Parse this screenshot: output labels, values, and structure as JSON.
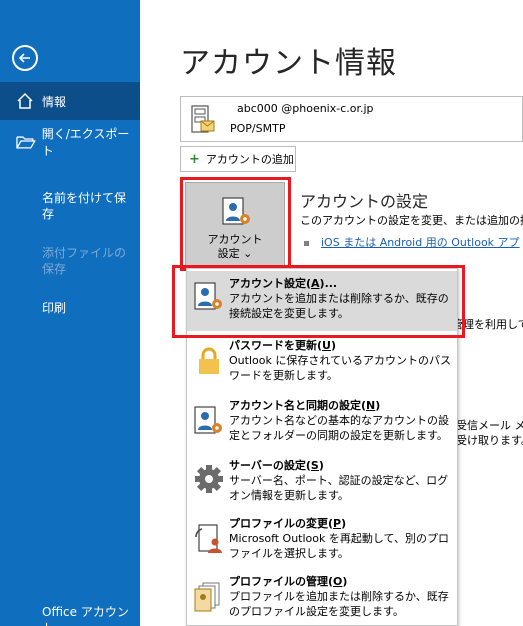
{
  "sidebar": {
    "info": "情報",
    "open_export": "開く/エクスポート",
    "save_as": "名前を付けて保存",
    "save_attachments": "添付ファイルの保存",
    "print": "印刷",
    "office_account": "Office アカウント"
  },
  "page_title": "アカウント情報",
  "account": {
    "email": "abc000 @phoenix-c.or.jp",
    "type": "POP/SMTP"
  },
  "add_account_label": "アカウントの追加",
  "account_settings_button": {
    "line1": "アカウント",
    "line2": "設定 ⌄"
  },
  "section": {
    "title": "アカウントの設定",
    "description": "このアカウントの設定を変更、または追加の接続",
    "link": "iOS または Android 用の Outlook アプ"
  },
  "background_fragments": {
    "frag1": "管理を利用して",
    "frag2_line1": "受信メール メ",
    "frag2_line2": "受け取ります。"
  },
  "menu": [
    {
      "title": "アカウント設定(",
      "accel": "A",
      "title_end": ")...",
      "desc": "アカウントを追加または削除するか、既存の接続設定を変更します。",
      "icon": "account-settings-icon"
    },
    {
      "title": "パスワードを更新(",
      "accel": "U",
      "title_end": ")",
      "desc": "Outlook に保存されているアカウントのパスワードを更新します。",
      "icon": "lock-icon"
    },
    {
      "title": "アカウント名と同期の設定(",
      "accel": "N",
      "title_end": ")",
      "desc": "アカウント名などの基本的なアカウントの設定とフォルダーの同期の設定を更新します。",
      "icon": "account-sync-icon"
    },
    {
      "title": "サーバーの設定(",
      "accel": "S",
      "title_end": ")",
      "desc": "サーバー名、ポート、認証の設定など、ログオン情報を更新します。",
      "icon": "gear-icon"
    },
    {
      "title": "プロファイルの変更(",
      "accel": "P",
      "title_end": ")",
      "desc": "Microsoft Outlook を再起動して、別のプロファイルを選択します。",
      "icon": "profile-change-icon"
    },
    {
      "title": "プロファイルの管理(",
      "accel": "O",
      "title_end": ")",
      "desc": "プロファイルを追加または削除するか、既存のプロファイル設定を変更します。",
      "icon": "profile-manage-icon"
    }
  ],
  "colors": {
    "sidebar": "#106ebe",
    "sidebar_selected": "#0b4e8a",
    "highlight": "#e8191f",
    "link": "#1a5fb4"
  }
}
